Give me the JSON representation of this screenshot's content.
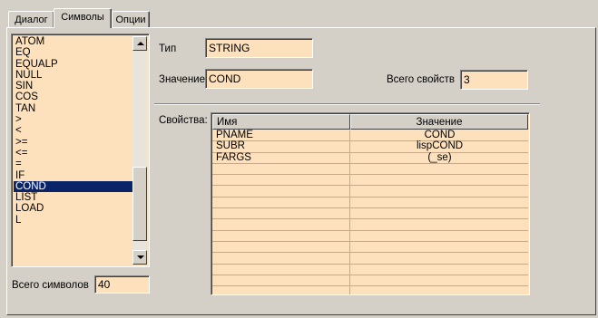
{
  "tabs": [
    {
      "label": "Диалог",
      "active": false
    },
    {
      "label": "Символы",
      "active": true
    },
    {
      "label": "Опции",
      "active": false
    }
  ],
  "symbol_list": {
    "items": [
      "ATOM",
      "EQ",
      "EQUALP",
      "NULL",
      "SIN",
      "COS",
      "TAN",
      ">",
      "<",
      ">=",
      "<=",
      "=",
      "IF",
      "COND",
      "LIST",
      "LOAD",
      "L"
    ],
    "selected": "COND"
  },
  "type_label": "Тип",
  "type_value": "STRING",
  "value_label": "Значение",
  "value_value": "COND",
  "total_props_label": "Всего свойств",
  "total_props_value": "3",
  "properties_label": "Свойства:",
  "properties_table": {
    "columns": [
      "Имя",
      "Значение"
    ],
    "rows": [
      {
        "name": "PNAME",
        "value": "COND"
      },
      {
        "name": "SUBR",
        "value": "lispCOND"
      },
      {
        "name": "FARGS",
        "value": "(_se)"
      }
    ]
  },
  "total_symbols_label": "Всего символов",
  "total_symbols_value": "40",
  "colors": {
    "window_bg": "#d4d0c8",
    "field_bg": "#fde0bc",
    "selection": "#0a246a"
  }
}
